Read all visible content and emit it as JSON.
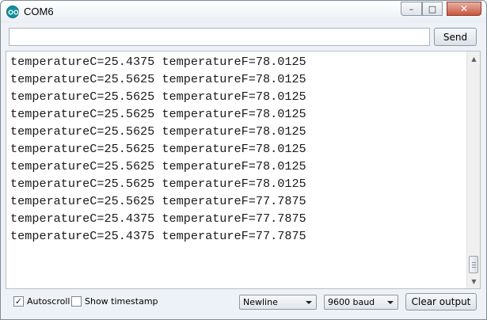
{
  "window": {
    "title": "COM6",
    "minimize_glyph": "–",
    "maximize_glyph": "□",
    "close_glyph": "✕"
  },
  "send_row": {
    "input_value": "",
    "input_placeholder": "",
    "send_label": "Send"
  },
  "output": {
    "lines": [
      "temperatureC=25.4375 temperatureF=78.0125",
      "temperatureC=25.5625 temperatureF=78.0125",
      "temperatureC=25.5625 temperatureF=78.0125",
      "temperatureC=25.5625 temperatureF=78.0125",
      "temperatureC=25.5625 temperatureF=78.0125",
      "temperatureC=25.5625 temperatureF=78.0125",
      "temperatureC=25.5625 temperatureF=78.0125",
      "temperatureC=25.5625 temperatureF=78.0125",
      "temperatureC=25.5625 temperatureF=77.7875",
      "temperatureC=25.4375 temperatureF=77.7875",
      "temperatureC=25.4375 temperatureF=77.7875"
    ]
  },
  "bottom_bar": {
    "autoscroll_label": "Autoscroll",
    "autoscroll_checked": true,
    "timestamp_label": "Show timestamp",
    "timestamp_checked": false,
    "line_ending_selected": "Newline",
    "baud_selected": "9600 baud",
    "clear_label": "Clear output"
  },
  "colors": {
    "app_icon": "#12939f",
    "close_button": "#c9573f"
  },
  "icons": {
    "app": "arduino-icon",
    "check": "✓"
  }
}
